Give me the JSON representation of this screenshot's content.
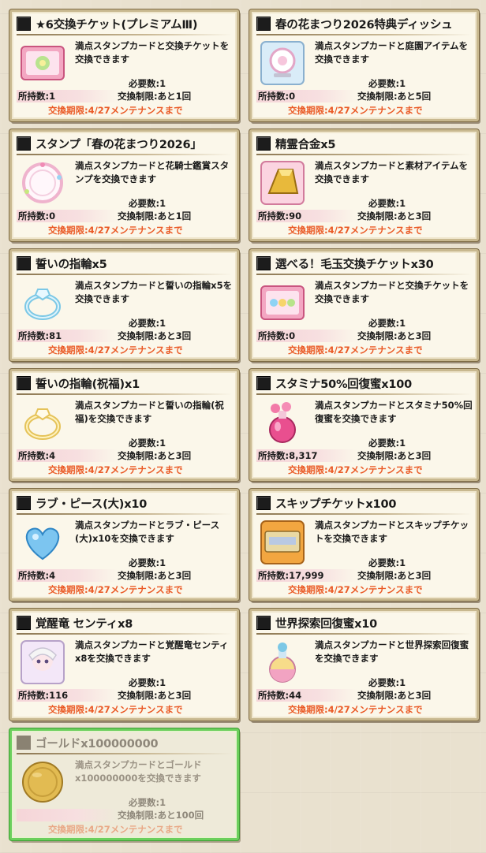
{
  "labels": {
    "required": "必要数:1",
    "deadline": "交換期限:4/27メンテナンスまで"
  },
  "cards": [
    {
      "title": "★6交換チケット(プレミアムⅢ)",
      "desc": "満点スタンプカードと交換チケットを交換できます",
      "owned": "所持数:1",
      "limit": "交換制限:あと1回",
      "icon": "ticket-icon",
      "disabled": false
    },
    {
      "title": "春の花まつり2026特典ディッシュ",
      "desc": "満点スタンプカードと庭園アイテムを交換できます",
      "owned": "所持数:0",
      "limit": "交換制限:あと5回",
      "icon": "dish-icon",
      "disabled": false
    },
    {
      "title": "スタンプ「春の花まつり2026」",
      "desc": "満点スタンプカードと花騎士鑑賞スタンプを交換できます",
      "owned": "所持数:0",
      "limit": "交換制限:あと1回",
      "icon": "stamp-icon",
      "disabled": false
    },
    {
      "title": "精霊合金x5",
      "desc": "満点スタンプカードと素材アイテムを交換できます",
      "owned": "所持数:90",
      "limit": "交換制限:あと3回",
      "icon": "gold-ingot-icon",
      "disabled": false
    },
    {
      "title": "誓いの指輪x5",
      "desc": "満点スタンプカードと誓いの指輪x5を交換できます",
      "owned": "所持数:81",
      "limit": "交換制限:あと3回",
      "icon": "ring-icon",
      "disabled": false
    },
    {
      "title": "選べる！毛玉交換チケットx30",
      "desc": "満点スタンプカードと交換チケットを交換できます",
      "owned": "所持数:0",
      "limit": "交換制限:あと3回",
      "icon": "furball-ticket-icon",
      "disabled": false
    },
    {
      "title": "誓いの指輪(祝福)x1",
      "desc": "満点スタンプカードと誓いの指輪(祝福)を交換できます",
      "owned": "所持数:4",
      "limit": "交換制限:あと3回",
      "icon": "blessed-ring-icon",
      "disabled": false
    },
    {
      "title": "スタミナ50%回復蜜x100",
      "desc": "満点スタンプカードとスタミナ50%回復蜜を交換できます",
      "owned": "所持数:8,317",
      "limit": "交換制限:あと3回",
      "icon": "stamina-potion-icon",
      "disabled": false
    },
    {
      "title": "ラブ・ピース(大)x10",
      "desc": "満点スタンプカードとラブ・ピース(大)x10を交換できます",
      "owned": "所持数:4",
      "limit": "交換制限:あと3回",
      "icon": "love-piece-icon",
      "disabled": false
    },
    {
      "title": "スキップチケットx100",
      "desc": "満点スタンプカードとスキップチケットを交換できます",
      "owned": "所持数:17,999",
      "limit": "交換制限:あと3回",
      "icon": "skip-ticket-icon",
      "disabled": false
    },
    {
      "title": "覚醒竜 センティx8",
      "desc": "満点スタンプカードと覚醒竜センティx8を交換できます",
      "owned": "所持数:116",
      "limit": "交換制限:あと3回",
      "icon": "dragon-icon",
      "disabled": false
    },
    {
      "title": "世界探索回復蜜x10",
      "desc": "満点スタンプカードと世界探索回復蜜を交換できます",
      "owned": "所持数:44",
      "limit": "交換制限:あと3回",
      "icon": "explore-potion-icon",
      "disabled": false
    },
    {
      "title": "ゴールドx100000000",
      "desc": "満点スタンプカードとゴールドx100000000を交換できます",
      "owned": "",
      "limit": "交換制限:あと100回",
      "icon": "gold-coin-icon",
      "disabled": true
    }
  ]
}
